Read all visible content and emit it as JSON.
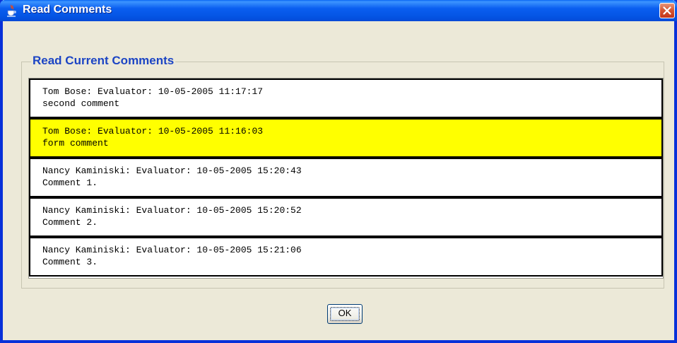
{
  "window": {
    "title": "Read Comments",
    "close_icon": "close-icon"
  },
  "group": {
    "label": "Read Current Comments"
  },
  "comments": [
    {
      "header": "Tom Bose: Evaluator: 10-05-2005 11:17:17",
      "text": "second comment",
      "selected": false
    },
    {
      "header": "Tom Bose: Evaluator: 10-05-2005 11:16:03",
      "text": "form comment",
      "selected": true
    },
    {
      "header": "Nancy Kaminiski: Evaluator: 10-05-2005 15:20:43",
      "text": "Comment 1.",
      "selected": false
    },
    {
      "header": "Nancy Kaminiski: Evaluator: 10-05-2005 15:20:52",
      "text": "Comment 2.",
      "selected": false
    },
    {
      "header": "Nancy Kaminiski: Evaluator: 10-05-2005 15:21:06",
      "text": "Comment 3.",
      "selected": false
    }
  ],
  "buttons": {
    "ok_label": "OK"
  },
  "colors": {
    "selected_row": "#ffff00",
    "group_label": "#1b44c4",
    "titlebar": "#0a5ef0"
  }
}
